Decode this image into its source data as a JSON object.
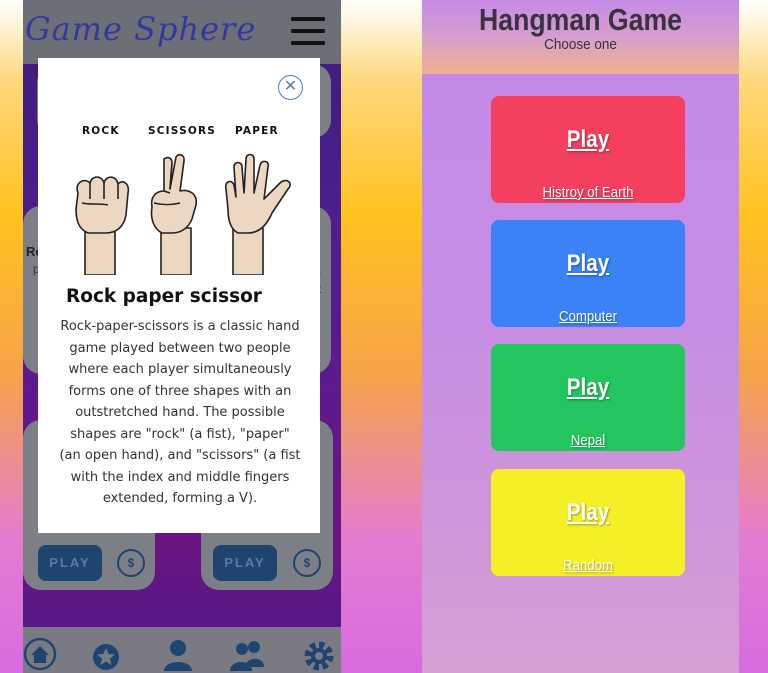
{
  "left_app": {
    "logo": "Game Sphere",
    "cards": {
      "play_label": "PLAY",
      "coin_symbol": "$"
    },
    "modal": {
      "labels": [
        "ROCK",
        "SCISSORS",
        "PAPER"
      ],
      "title": "Rock paper scissor",
      "description": "Rock-paper-scissors is a classic hand game played between two people where each player simultaneously forms one of three shapes with an outstretched hand. The possible shapes are \"rock\" (a fist), \"paper\" (an open hand), and \"scissors\" (a fist with the index and middle fingers extended, forming a V)."
    },
    "bottom_nav": [
      "home-icon",
      "star-icon",
      "user-icon",
      "users-icon",
      "gear-icon"
    ]
  },
  "right_app": {
    "title": "Hangman Game",
    "subtitle": "Choose one",
    "categories": [
      {
        "play": "Play",
        "name": "Histroy of Earth",
        "color": "#f43f5e"
      },
      {
        "play": "Play",
        "name": "Computer",
        "color": "#3b82f6"
      },
      {
        "play": "Play",
        "name": "Nepal",
        "color": "#22c55e"
      },
      {
        "play": "Play",
        "name": "Random",
        "color": "#f5ef27"
      }
    ]
  }
}
